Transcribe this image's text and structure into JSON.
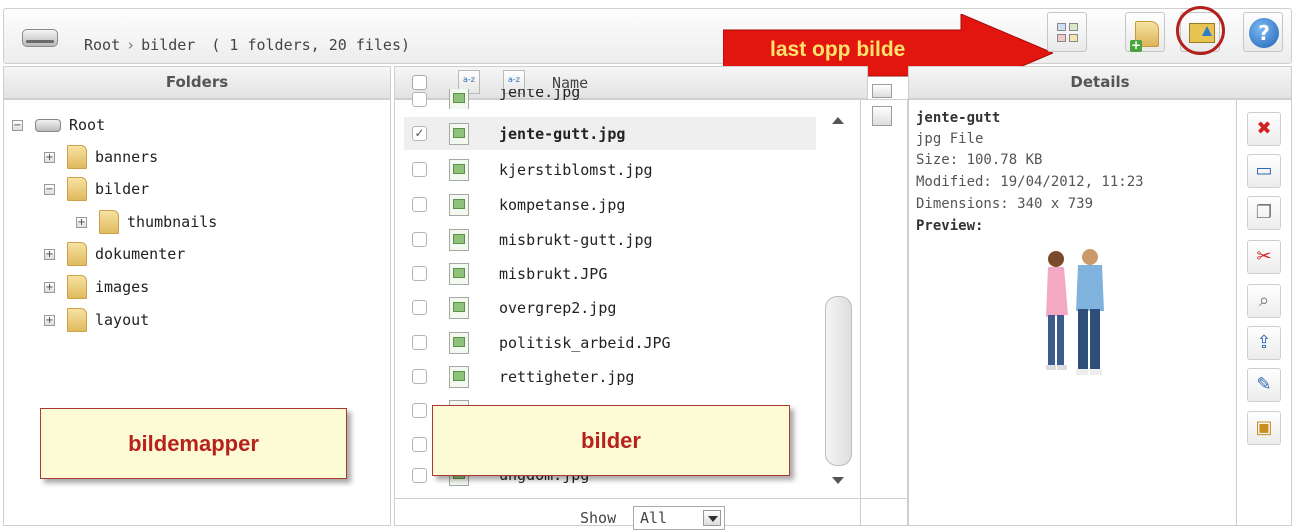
{
  "toolbar": {
    "breadcrumb_root": "Root",
    "breadcrumb_sep": "›",
    "breadcrumb_current": "bilder",
    "summary": "( 1 folders, 20 files)",
    "buttons": [
      "view-toggle-icon",
      "new-folder-icon",
      "upload-image-icon",
      "help-icon"
    ],
    "help_label": "?"
  },
  "annotation_arrow": {
    "label": "last opp bilde",
    "color": "#e3150f",
    "text_color": "#ffe36b"
  },
  "folders_panel": {
    "title": "Folders",
    "items": [
      {
        "label": "Root",
        "expander": "−"
      },
      {
        "label": "banners",
        "expander": "+"
      },
      {
        "label": "bilder",
        "expander": "−"
      },
      {
        "label": "thumbnails",
        "expander": "+"
      },
      {
        "label": "dokumenter",
        "expander": "+"
      },
      {
        "label": "images",
        "expander": "+"
      },
      {
        "label": "layout",
        "expander": "+"
      }
    ]
  },
  "files_panel": {
    "column_name": "Name",
    "files": [
      {
        "name": "jente.jpg",
        "checked": false
      },
      {
        "name": "jente-gutt.jpg",
        "checked": true
      },
      {
        "name": "kjerstiblomst.jpg",
        "checked": false
      },
      {
        "name": "kompetanse.jpg",
        "checked": false
      },
      {
        "name": "misbrukt-gutt.jpg",
        "checked": false
      },
      {
        "name": "misbrukt.JPG",
        "checked": false
      },
      {
        "name": "overgrep2.jpg",
        "checked": false
      },
      {
        "name": "politisk_arbeid.JPG",
        "checked": false
      },
      {
        "name": "rettigheter.jpg",
        "checked": false
      },
      {
        "name": "",
        "checked": false
      },
      {
        "name": "",
        "checked": false
      },
      {
        "name": "ungdom.jpg",
        "checked": false
      }
    ],
    "show_label": "Show",
    "show_value": "All"
  },
  "details_panel": {
    "title": "Details",
    "file_title": "jente-gutt",
    "type": "jpg File",
    "size": "Size: 100.78 KB",
    "modified": "Modified: 19/04/2012, 11:23",
    "dimensions": "Dimensions: 340 x 739",
    "preview_label": "Preview:"
  },
  "callouts": {
    "folders": "bildemapper",
    "files": "bilder"
  }
}
